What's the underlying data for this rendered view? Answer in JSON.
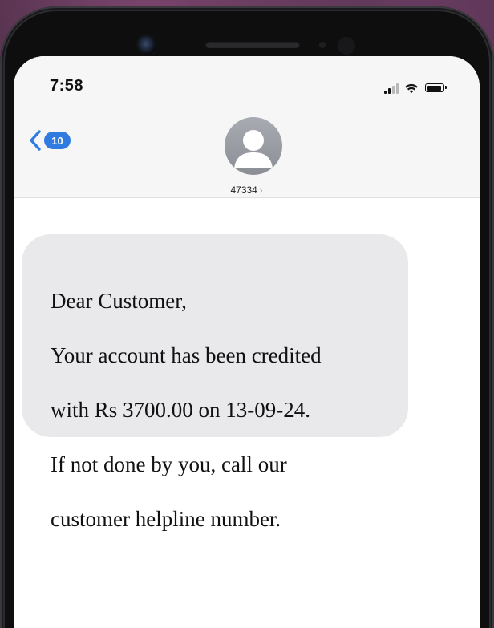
{
  "status_bar": {
    "time": "7:58",
    "icons": [
      "cellular-signal-icon",
      "wifi-icon",
      "battery-icon"
    ]
  },
  "conversation_header": {
    "back_badge_count": "10",
    "contact_name": "47334",
    "contact_chevron": "›",
    "avatar_icon": "person-silhouette-icon"
  },
  "messages": [
    {
      "direction": "incoming",
      "lines": [
        "Dear Customer,",
        "Your account has been credited",
        "with Rs 3700.00 on 13-09-24.",
        "If not done by you, call our",
        "customer helpline number."
      ]
    }
  ],
  "colors": {
    "accent_blue": "#2f7be0",
    "bubble_gray": "#e9e9eb",
    "header_bg": "#f6f6f7",
    "avatar_gray": "#9a9ca3",
    "background_purple": "#3a2538"
  }
}
